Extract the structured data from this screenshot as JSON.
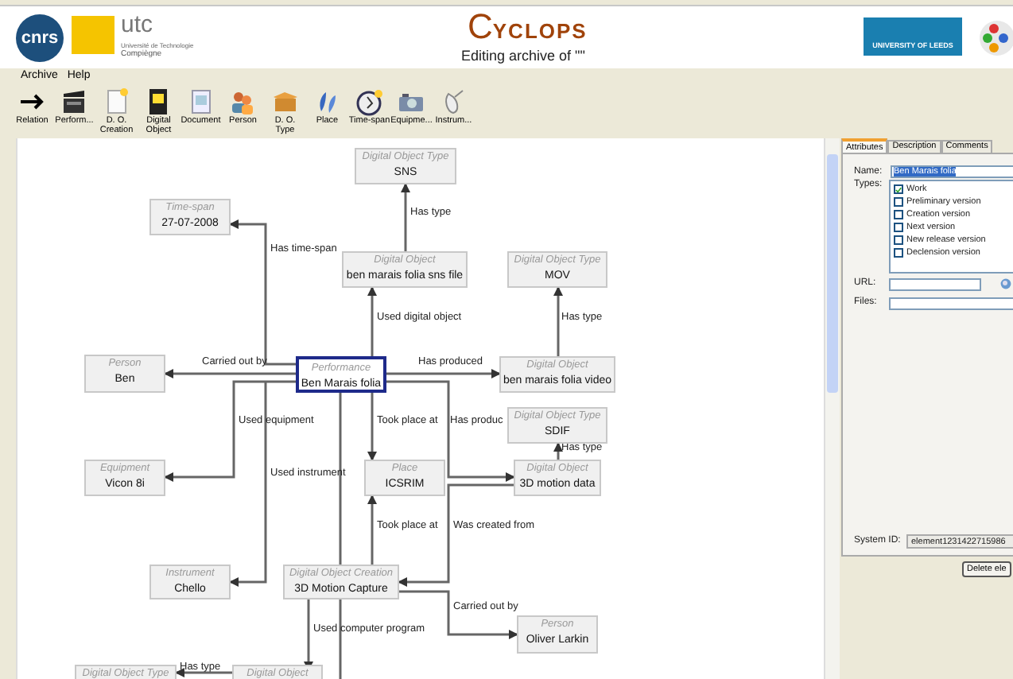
{
  "header": {
    "logo_left": {
      "mark": "cnrs"
    },
    "logo_utc": {
      "mark": "utc",
      "line_1": "Université de Technologie",
      "line_2": "Compiègne"
    },
    "app_title": {
      "initial": "C",
      "rest": "YCLOPS"
    },
    "subtitle": "Editing archive of \"\"",
    "logo_right": {
      "text": "UNIVERSITY OF LEEDS"
    }
  },
  "menu": [
    "Archive",
    "Help"
  ],
  "toolbar": [
    {
      "label": "Relation"
    },
    {
      "label": "Perform..."
    },
    {
      "label": "D. O. Creation"
    },
    {
      "label": "Digital Object"
    },
    {
      "label": "Document"
    },
    {
      "label": "Person"
    },
    {
      "label": "D. O. Type"
    },
    {
      "label": "Place"
    },
    {
      "label": "Time-span"
    },
    {
      "label": "Equipme..."
    },
    {
      "label": "Instrum..."
    }
  ],
  "diagram": {
    "nodes": [
      {
        "type": "Digital Object Type",
        "name": "SNS",
        "selected": false
      },
      {
        "type": "Time-span",
        "name": "27-07-2008",
        "selected": false
      },
      {
        "type": "Digital Object",
        "name": "ben marais folia sns file",
        "selected": false
      },
      {
        "type": "Digital Object Type",
        "name": "MOV",
        "selected": false
      },
      {
        "type": "Person",
        "name": "Ben",
        "selected": false
      },
      {
        "type": "Performance",
        "name": "Ben Marais folia",
        "selected": true
      },
      {
        "type": "Digital Object",
        "name": "ben marais folia video",
        "selected": false
      },
      {
        "type": "Digital Object Type",
        "name": "SDIF",
        "selected": false
      },
      {
        "type": "Equipment",
        "name": "Vicon 8i",
        "selected": false
      },
      {
        "type": "Place",
        "name": "ICSRIM",
        "selected": false
      },
      {
        "type": "Digital Object",
        "name": "3D motion data",
        "selected": false
      },
      {
        "type": "Instrument",
        "name": "Chello",
        "selected": false
      },
      {
        "type": "Digital Object Creation",
        "name": "3D Motion Capture",
        "selected": false
      },
      {
        "type": "Person",
        "name": "Oliver Larkin",
        "selected": false
      },
      {
        "type": "Digital Object Type",
        "selected": false
      },
      {
        "type": "Digital Object",
        "selected": false
      }
    ],
    "edges": [
      {
        "label": "Has type"
      },
      {
        "label": "Has time-span"
      },
      {
        "label": "Used digital object"
      },
      {
        "label": "Has type"
      },
      {
        "label": "Carried out by"
      },
      {
        "label": "Has produced"
      },
      {
        "label": "Has produc"
      },
      {
        "label": "Has type"
      },
      {
        "label": "Used equipment"
      },
      {
        "label": "Used instrument"
      },
      {
        "label": "Took place at"
      },
      {
        "label": "Took place at"
      },
      {
        "label": "Was created from"
      },
      {
        "label": "Carried out by"
      },
      {
        "label": "Used computer program"
      },
      {
        "label": "Has type"
      }
    ]
  },
  "panel": {
    "tabs": [
      {
        "label": "Attributes",
        "selected": true
      },
      {
        "label": "Description",
        "selected": false
      },
      {
        "label": "Comments",
        "selected": false
      }
    ],
    "name_label": "Name:",
    "name_value": "Ben Marais folia",
    "types_label": "Types:",
    "types": [
      {
        "label": "Work",
        "checked": true
      },
      {
        "label": "Preliminary version",
        "checked": false
      },
      {
        "label": "Creation version",
        "checked": false
      },
      {
        "label": "Next version",
        "checked": false
      },
      {
        "label": "New release version",
        "checked": false
      },
      {
        "label": "Declension version",
        "checked": false
      }
    ],
    "url_label": "URL:",
    "files_label": "Files:",
    "system_id_label": "System ID:",
    "system_id": "element1231422715986",
    "delete_button": "Delete ele"
  }
}
